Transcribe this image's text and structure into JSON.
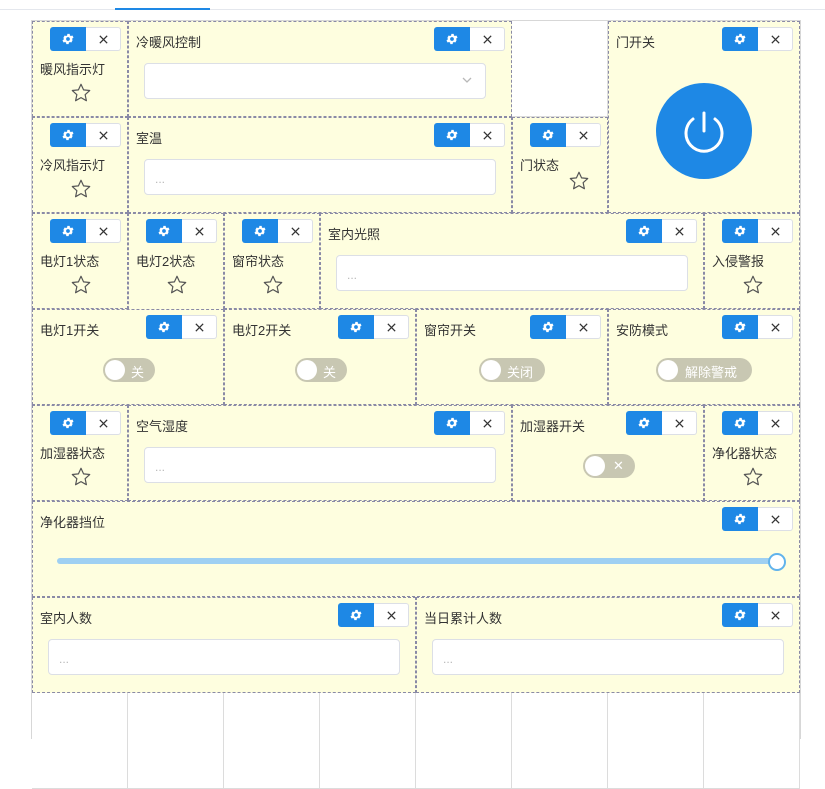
{
  "icons": {
    "gear": "gear-icon",
    "close": "close-icon",
    "star": "star-icon",
    "power": "power-icon",
    "chevron": "chevron-down-icon"
  },
  "colors": {
    "accent": "#1e88e5",
    "widget_bg": "#fefedf",
    "toggle_off": "#c8c7b2"
  },
  "widgets": {
    "warm_light": {
      "title": "暖风指示灯"
    },
    "hvac_control": {
      "title": "冷暖风控制",
      "value": ""
    },
    "door_switch": {
      "title": "门开关"
    },
    "cold_light": {
      "title": "冷风指示灯"
    },
    "room_temp": {
      "title": "室温",
      "placeholder": "..."
    },
    "door_status": {
      "title": "门状态"
    },
    "lamp1_status": {
      "title": "电灯1状态"
    },
    "lamp2_status": {
      "title": "电灯2状态"
    },
    "curtain_status": {
      "title": "窗帘状态"
    },
    "indoor_light": {
      "title": "室内光照",
      "placeholder": "..."
    },
    "intrusion_alarm": {
      "title": "入侵警报"
    },
    "lamp1_switch": {
      "title": "电灯1开关",
      "toggle": "关"
    },
    "lamp2_switch": {
      "title": "电灯2开关",
      "toggle": "关"
    },
    "curtain_switch": {
      "title": "窗帘开关",
      "toggle": "关闭"
    },
    "security_mode": {
      "title": "安防模式",
      "toggle": "解除警戒"
    },
    "humidifier_status": {
      "title": "加湿器状态"
    },
    "air_humidity": {
      "title": "空气湿度",
      "placeholder": "..."
    },
    "humidifier_switch": {
      "title": "加湿器开关",
      "toggle": "✕"
    },
    "purifier_status": {
      "title": "净化器状态"
    },
    "purifier_level": {
      "title": "净化器挡位",
      "value_fraction": 1.0
    },
    "indoor_people": {
      "title": "室内人数",
      "placeholder": "..."
    },
    "daily_people": {
      "title": "当日累计人数",
      "placeholder": "..."
    }
  }
}
